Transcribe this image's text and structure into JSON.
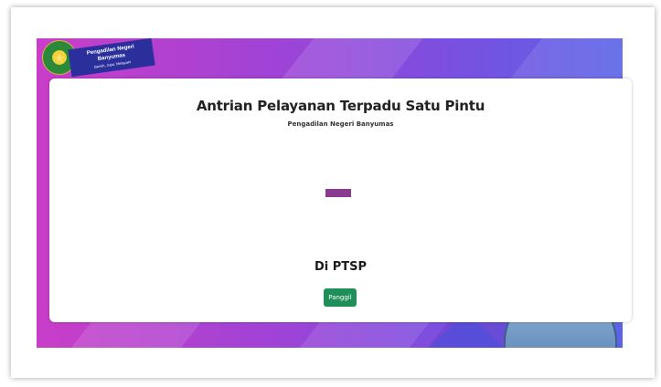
{
  "header": {
    "logo": {
      "name": "Pengadilan Negeri Banyumas",
      "ribbon_line1": "Pengadilan Negeri",
      "ribbon_line2": "Banyumas",
      "ribbon_tagline": "Bersih, Jujur, Melayani",
      "emblem_icon": "court-emblem-icon"
    }
  },
  "main": {
    "title": "Antrian Pelayanan Terpadu Satu Pintu",
    "subtitle": "Pengadilan Negeri Banyumas",
    "queue_indicator_color": "#8a3a8f",
    "location_label": "Di PTSP",
    "call_button_label": "Panggil",
    "call_button_color": "#1f8f5a"
  },
  "theme": {
    "banner_gradient": [
      "#c93ec8",
      "#a043d6",
      "#7b4fe0",
      "#5a63e6"
    ]
  }
}
